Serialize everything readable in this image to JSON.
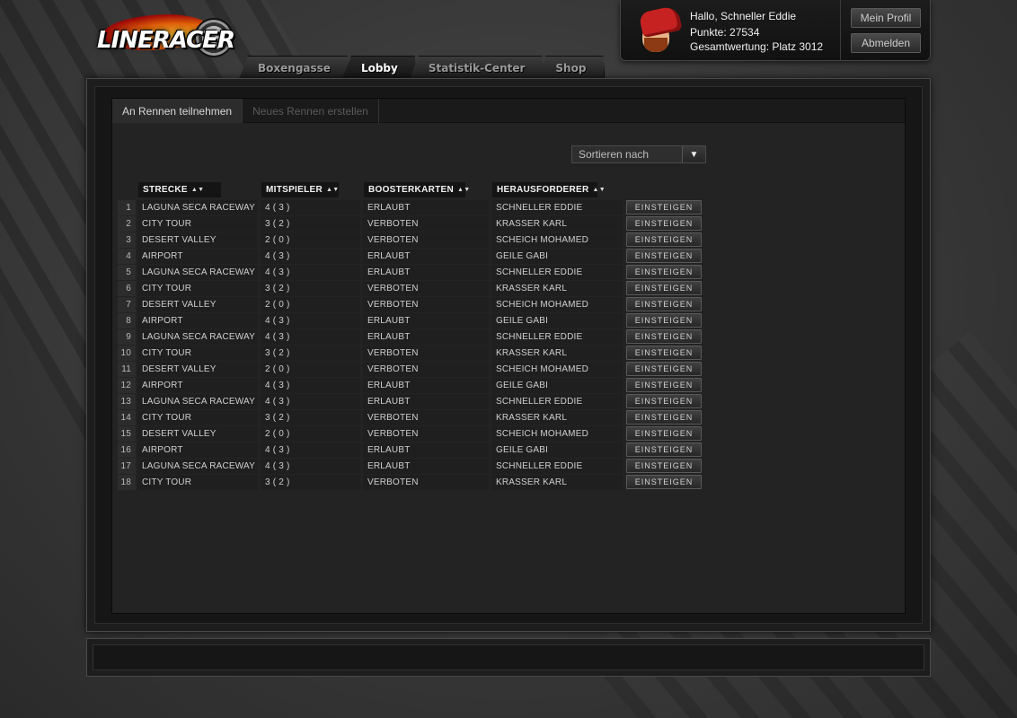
{
  "app": {
    "logo_text": "LINERACER"
  },
  "nav": {
    "tabs": [
      {
        "label": "Boxengasse",
        "active": false
      },
      {
        "label": "Lobby",
        "active": true
      },
      {
        "label": "Statistik-Center",
        "active": false
      },
      {
        "label": "Shop",
        "active": false
      }
    ]
  },
  "user": {
    "greeting": "Hallo, Schneller Eddie",
    "points": "Punkte: 27534",
    "ranking": "Gesamtwertung: Platz 3012",
    "profile_button": "Mein Profil",
    "logout_button": "Abmelden"
  },
  "content_tabs": [
    {
      "label": "An Rennen teilnehmen",
      "active": true
    },
    {
      "label": "Neues Rennen erstellen",
      "active": false
    }
  ],
  "sort": {
    "label": "Sortieren nach",
    "arrow": "▼"
  },
  "table": {
    "columns": [
      "STRECKE",
      "MITSPIELER",
      "BOOSTERKARTEN",
      "HERAUSFORDERER"
    ],
    "sort_icon": "▲▼",
    "join_label": "EINSTEIGEN",
    "rows": [
      {
        "n": "1",
        "track": "LAGUNA SECA RACEWAY",
        "players": "4 ( 3 )",
        "booster": "ERLAUBT",
        "challenger": "SCHNELLER EDDIE"
      },
      {
        "n": "2",
        "track": "CITY TOUR",
        "players": "3 ( 2 )",
        "booster": "VERBOTEN",
        "challenger": "KRASSER KARL"
      },
      {
        "n": "3",
        "track": "DESERT VALLEY",
        "players": "2 ( 0 )",
        "booster": "VERBOTEN",
        "challenger": "SCHEICH MOHAMED"
      },
      {
        "n": "4",
        "track": "AIRPORT",
        "players": "4 ( 3 )",
        "booster": "ERLAUBT",
        "challenger": "GEILE GABI"
      },
      {
        "n": "5",
        "track": "LAGUNA SECA RACEWAY",
        "players": "4 ( 3 )",
        "booster": "ERLAUBT",
        "challenger": "SCHNELLER EDDIE"
      },
      {
        "n": "6",
        "track": "CITY TOUR",
        "players": "3 ( 2 )",
        "booster": "VERBOTEN",
        "challenger": "KRASSER KARL"
      },
      {
        "n": "7",
        "track": "DESERT VALLEY",
        "players": "2 ( 0 )",
        "booster": "VERBOTEN",
        "challenger": "SCHEICH MOHAMED"
      },
      {
        "n": "8",
        "track": "AIRPORT",
        "players": "4 ( 3 )",
        "booster": "ERLAUBT",
        "challenger": "GEILE GABI"
      },
      {
        "n": "9",
        "track": "LAGUNA SECA RACEWAY",
        "players": "4 ( 3 )",
        "booster": "ERLAUBT",
        "challenger": "SCHNELLER EDDIE"
      },
      {
        "n": "10",
        "track": "CITY TOUR",
        "players": "3 ( 2 )",
        "booster": "VERBOTEN",
        "challenger": "KRASSER KARL"
      },
      {
        "n": "11",
        "track": "DESERT VALLEY",
        "players": "2 ( 0 )",
        "booster": "VERBOTEN",
        "challenger": "SCHEICH MOHAMED"
      },
      {
        "n": "12",
        "track": "AIRPORT",
        "players": "4 ( 3 )",
        "booster": "ERLAUBT",
        "challenger": "GEILE GABI"
      },
      {
        "n": "13",
        "track": "LAGUNA SECA RACEWAY",
        "players": "4 ( 3 )",
        "booster": "ERLAUBT",
        "challenger": "SCHNELLER EDDIE"
      },
      {
        "n": "14",
        "track": "CITY TOUR",
        "players": "3 ( 2 )",
        "booster": "VERBOTEN",
        "challenger": "KRASSER KARL"
      },
      {
        "n": "15",
        "track": "DESERT VALLEY",
        "players": "2 ( 0 )",
        "booster": "VERBOTEN",
        "challenger": "SCHEICH MOHAMED"
      },
      {
        "n": "16",
        "track": "AIRPORT",
        "players": "4 ( 3 )",
        "booster": "ERLAUBT",
        "challenger": "GEILE GABI"
      },
      {
        "n": "17",
        "track": "LAGUNA SECA RACEWAY",
        "players": "4 ( 3 )",
        "booster": "ERLAUBT",
        "challenger": "SCHNELLER EDDIE"
      },
      {
        "n": "18",
        "track": "CITY TOUR",
        "players": "3 ( 2 )",
        "booster": "VERBOTEN",
        "challenger": "KRASSER KARL"
      }
    ]
  }
}
